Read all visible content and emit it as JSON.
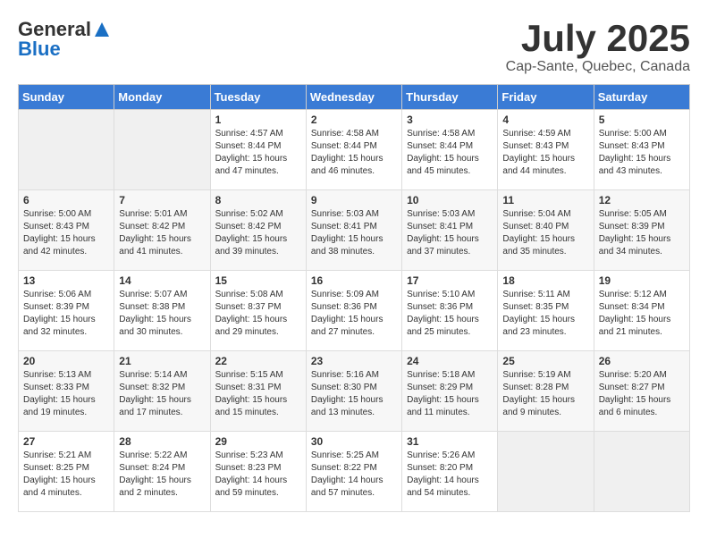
{
  "header": {
    "logo_general": "General",
    "logo_blue": "Blue",
    "month_year": "July 2025",
    "location": "Cap-Sante, Quebec, Canada"
  },
  "days_of_week": [
    "Sunday",
    "Monday",
    "Tuesday",
    "Wednesday",
    "Thursday",
    "Friday",
    "Saturday"
  ],
  "weeks": [
    [
      {
        "day": "",
        "sunrise": "",
        "sunset": "",
        "daylight": ""
      },
      {
        "day": "",
        "sunrise": "",
        "sunset": "",
        "daylight": ""
      },
      {
        "day": "1",
        "sunrise": "Sunrise: 4:57 AM",
        "sunset": "Sunset: 8:44 PM",
        "daylight": "Daylight: 15 hours and 47 minutes."
      },
      {
        "day": "2",
        "sunrise": "Sunrise: 4:58 AM",
        "sunset": "Sunset: 8:44 PM",
        "daylight": "Daylight: 15 hours and 46 minutes."
      },
      {
        "day": "3",
        "sunrise": "Sunrise: 4:58 AM",
        "sunset": "Sunset: 8:44 PM",
        "daylight": "Daylight: 15 hours and 45 minutes."
      },
      {
        "day": "4",
        "sunrise": "Sunrise: 4:59 AM",
        "sunset": "Sunset: 8:43 PM",
        "daylight": "Daylight: 15 hours and 44 minutes."
      },
      {
        "day": "5",
        "sunrise": "Sunrise: 5:00 AM",
        "sunset": "Sunset: 8:43 PM",
        "daylight": "Daylight: 15 hours and 43 minutes."
      }
    ],
    [
      {
        "day": "6",
        "sunrise": "Sunrise: 5:00 AM",
        "sunset": "Sunset: 8:43 PM",
        "daylight": "Daylight: 15 hours and 42 minutes."
      },
      {
        "day": "7",
        "sunrise": "Sunrise: 5:01 AM",
        "sunset": "Sunset: 8:42 PM",
        "daylight": "Daylight: 15 hours and 41 minutes."
      },
      {
        "day": "8",
        "sunrise": "Sunrise: 5:02 AM",
        "sunset": "Sunset: 8:42 PM",
        "daylight": "Daylight: 15 hours and 39 minutes."
      },
      {
        "day": "9",
        "sunrise": "Sunrise: 5:03 AM",
        "sunset": "Sunset: 8:41 PM",
        "daylight": "Daylight: 15 hours and 38 minutes."
      },
      {
        "day": "10",
        "sunrise": "Sunrise: 5:03 AM",
        "sunset": "Sunset: 8:41 PM",
        "daylight": "Daylight: 15 hours and 37 minutes."
      },
      {
        "day": "11",
        "sunrise": "Sunrise: 5:04 AM",
        "sunset": "Sunset: 8:40 PM",
        "daylight": "Daylight: 15 hours and 35 minutes."
      },
      {
        "day": "12",
        "sunrise": "Sunrise: 5:05 AM",
        "sunset": "Sunset: 8:39 PM",
        "daylight": "Daylight: 15 hours and 34 minutes."
      }
    ],
    [
      {
        "day": "13",
        "sunrise": "Sunrise: 5:06 AM",
        "sunset": "Sunset: 8:39 PM",
        "daylight": "Daylight: 15 hours and 32 minutes."
      },
      {
        "day": "14",
        "sunrise": "Sunrise: 5:07 AM",
        "sunset": "Sunset: 8:38 PM",
        "daylight": "Daylight: 15 hours and 30 minutes."
      },
      {
        "day": "15",
        "sunrise": "Sunrise: 5:08 AM",
        "sunset": "Sunset: 8:37 PM",
        "daylight": "Daylight: 15 hours and 29 minutes."
      },
      {
        "day": "16",
        "sunrise": "Sunrise: 5:09 AM",
        "sunset": "Sunset: 8:36 PM",
        "daylight": "Daylight: 15 hours and 27 minutes."
      },
      {
        "day": "17",
        "sunrise": "Sunrise: 5:10 AM",
        "sunset": "Sunset: 8:36 PM",
        "daylight": "Daylight: 15 hours and 25 minutes."
      },
      {
        "day": "18",
        "sunrise": "Sunrise: 5:11 AM",
        "sunset": "Sunset: 8:35 PM",
        "daylight": "Daylight: 15 hours and 23 minutes."
      },
      {
        "day": "19",
        "sunrise": "Sunrise: 5:12 AM",
        "sunset": "Sunset: 8:34 PM",
        "daylight": "Daylight: 15 hours and 21 minutes."
      }
    ],
    [
      {
        "day": "20",
        "sunrise": "Sunrise: 5:13 AM",
        "sunset": "Sunset: 8:33 PM",
        "daylight": "Daylight: 15 hours and 19 minutes."
      },
      {
        "day": "21",
        "sunrise": "Sunrise: 5:14 AM",
        "sunset": "Sunset: 8:32 PM",
        "daylight": "Daylight: 15 hours and 17 minutes."
      },
      {
        "day": "22",
        "sunrise": "Sunrise: 5:15 AM",
        "sunset": "Sunset: 8:31 PM",
        "daylight": "Daylight: 15 hours and 15 minutes."
      },
      {
        "day": "23",
        "sunrise": "Sunrise: 5:16 AM",
        "sunset": "Sunset: 8:30 PM",
        "daylight": "Daylight: 15 hours and 13 minutes."
      },
      {
        "day": "24",
        "sunrise": "Sunrise: 5:18 AM",
        "sunset": "Sunset: 8:29 PM",
        "daylight": "Daylight: 15 hours and 11 minutes."
      },
      {
        "day": "25",
        "sunrise": "Sunrise: 5:19 AM",
        "sunset": "Sunset: 8:28 PM",
        "daylight": "Daylight: 15 hours and 9 minutes."
      },
      {
        "day": "26",
        "sunrise": "Sunrise: 5:20 AM",
        "sunset": "Sunset: 8:27 PM",
        "daylight": "Daylight: 15 hours and 6 minutes."
      }
    ],
    [
      {
        "day": "27",
        "sunrise": "Sunrise: 5:21 AM",
        "sunset": "Sunset: 8:25 PM",
        "daylight": "Daylight: 15 hours and 4 minutes."
      },
      {
        "day": "28",
        "sunrise": "Sunrise: 5:22 AM",
        "sunset": "Sunset: 8:24 PM",
        "daylight": "Daylight: 15 hours and 2 minutes."
      },
      {
        "day": "29",
        "sunrise": "Sunrise: 5:23 AM",
        "sunset": "Sunset: 8:23 PM",
        "daylight": "Daylight: 14 hours and 59 minutes."
      },
      {
        "day": "30",
        "sunrise": "Sunrise: 5:25 AM",
        "sunset": "Sunset: 8:22 PM",
        "daylight": "Daylight: 14 hours and 57 minutes."
      },
      {
        "day": "31",
        "sunrise": "Sunrise: 5:26 AM",
        "sunset": "Sunset: 8:20 PM",
        "daylight": "Daylight: 14 hours and 54 minutes."
      },
      {
        "day": "",
        "sunrise": "",
        "sunset": "",
        "daylight": ""
      },
      {
        "day": "",
        "sunrise": "",
        "sunset": "",
        "daylight": ""
      }
    ]
  ]
}
